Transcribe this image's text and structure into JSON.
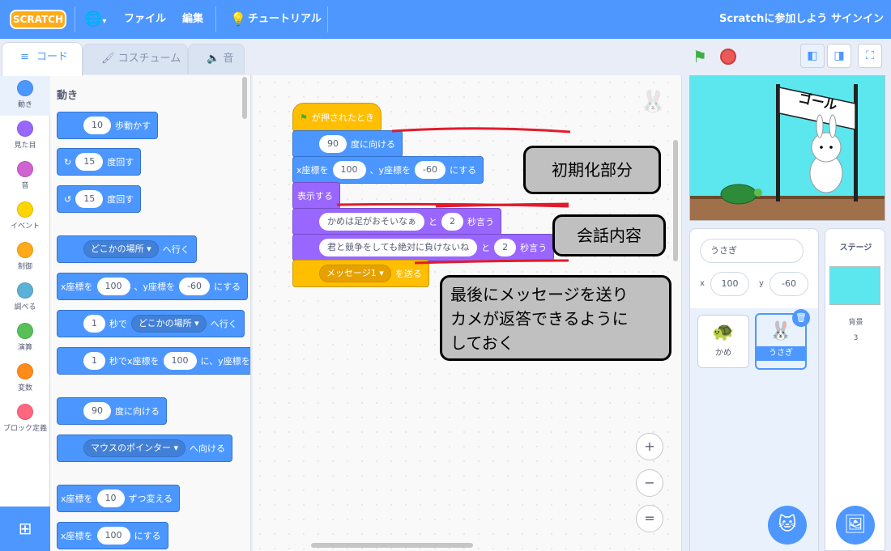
{
  "menu": {
    "logo": "SCRATCH",
    "file": "ファイル",
    "edit": "編集",
    "tutorial": "チュートリアル",
    "join": "Scratchに参加しよう",
    "signin": "サインイン"
  },
  "tabs": {
    "code": "コード",
    "costume": "コスチューム",
    "sound": "音"
  },
  "categories": [
    {
      "label": "動き",
      "color": "#4c97ff"
    },
    {
      "label": "見た目",
      "color": "#9966ff"
    },
    {
      "label": "音",
      "color": "#cf63cf"
    },
    {
      "label": "イベント",
      "color": "#ffd500"
    },
    {
      "label": "制御",
      "color": "#ffab19"
    },
    {
      "label": "調べる",
      "color": "#5cb1d6"
    },
    {
      "label": "演算",
      "color": "#59c059"
    },
    {
      "label": "変数",
      "color": "#ff8c1a"
    },
    {
      "label": "ブロック定義",
      "color": "#ff6680"
    }
  ],
  "palette": {
    "heading": "動き",
    "b1": {
      "v": "10",
      "t": "歩動かす"
    },
    "b2": {
      "v": "15",
      "t": "度回す"
    },
    "b3": {
      "v": "15",
      "t": "度回す"
    },
    "b4": {
      "dd": "どこかの場所",
      "t": "へ行く"
    },
    "b5": {
      "a": "x座標を",
      "x": "100",
      "b": "、y座標を",
      "y": "-60",
      "c": "にする"
    },
    "b6": {
      "v": "1",
      "a": "秒で",
      "dd": "どこかの場所",
      "t": "へ行く"
    },
    "b7": {
      "v": "1",
      "a": "秒でx座標を",
      "x": "100",
      "b": "に、y座標を"
    },
    "b8": {
      "v": "90",
      "t": "度に向ける"
    },
    "b9": {
      "dd": "マウスのポインター",
      "t": "へ向ける"
    },
    "b10": {
      "a": "x座標を",
      "v": "10",
      "t": "ずつ変える"
    },
    "b11": {
      "a": "x座標を",
      "v": "100",
      "t": "にする"
    }
  },
  "script": {
    "hat": "が押されたとき",
    "dir": {
      "v": "90",
      "t": "度に向ける"
    },
    "goto": {
      "a": "x座標を",
      "x": "100",
      "b": "、y座標を",
      "y": "-60",
      "c": "にする"
    },
    "show": "表示する",
    "say1": {
      "msg": "かめは足がおそいなぁ",
      "a": "と",
      "v": "2",
      "t": "秒言う"
    },
    "say2": {
      "msg": "君と競争をしても絶対に負けないね",
      "a": "と",
      "v": "2",
      "t": "秒言う"
    },
    "bc": {
      "dd": "メッセージ1",
      "t": "を送る"
    }
  },
  "notes": {
    "init": "初期化部分",
    "talk": "会話内容",
    "last1": "最後にメッセージを送り",
    "last2": "カメが返答できるように",
    "last3": "しておく"
  },
  "zoom": {
    "in": "+",
    "out": "−",
    "reset": "="
  },
  "stage": {
    "sign": "ゴール"
  },
  "sprite": {
    "name": "うさぎ",
    "x_label": "x",
    "x": "100",
    "y_label": "y",
    "y": "-60",
    "sprites": [
      "かめ",
      "うさぎ"
    ]
  },
  "stagepane": {
    "title": "ステージ",
    "bg_label": "背景",
    "bg_count": "3"
  }
}
